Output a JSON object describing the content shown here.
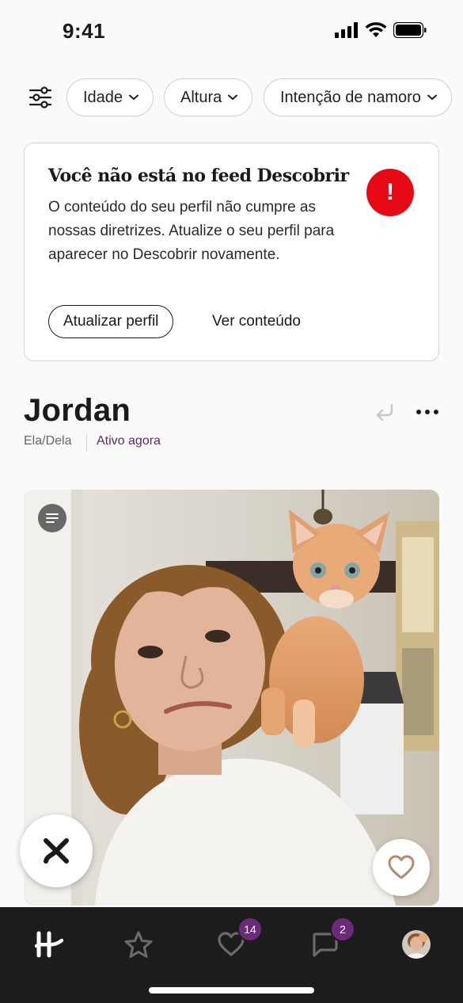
{
  "status_bar": {
    "time": "9:41",
    "icons": [
      "cellular-signal-icon",
      "wifi-icon",
      "battery-icon"
    ]
  },
  "filters": {
    "filter_icon": "sliders-icon",
    "chips": [
      {
        "label": "Idade"
      },
      {
        "label": "Altura"
      },
      {
        "label": "Intenção de namoro"
      }
    ]
  },
  "alert": {
    "title": "Você não está no feed Descobrir",
    "body": "O conteúdo do seu perfil não cumpre as nossas diretrizes. Atualize o seu perfil para aparecer no Descobrir novamente.",
    "badge": "!",
    "primary_button": "Atualizar perfil",
    "secondary_button": "Ver conteúdo",
    "badge_color": "#e60914"
  },
  "profile": {
    "name": "Jordan",
    "pronouns": "Ela/Dela",
    "activity": "Ativo agora",
    "activity_color": "#5d2a6b"
  },
  "tab_bar": {
    "items": [
      {
        "icon": "hinge-logo-icon"
      },
      {
        "icon": "star-icon"
      },
      {
        "icon": "likes-heart-icon",
        "badge": "14"
      },
      {
        "icon": "chat-bubble-icon",
        "badge": "2"
      },
      {
        "icon": "profile-avatar"
      }
    ],
    "badge_color": "#6b2a7a"
  }
}
